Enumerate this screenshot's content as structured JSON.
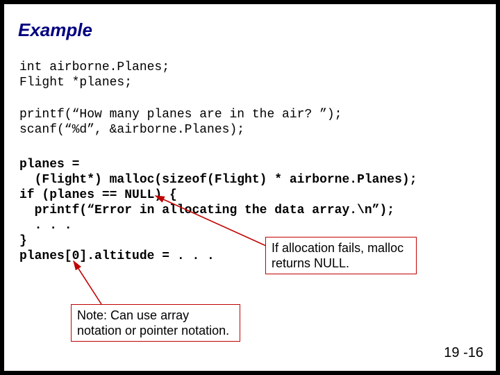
{
  "title": "Example",
  "code_block1": "int airborne.Planes;\nFlight *planes;",
  "code_block2": "printf(“How many planes are in the air? ”);\nscanf(“%d”, &airborne.Planes);",
  "code_block3": "planes =\n  (Flight*) malloc(sizeof(Flight) * airborne.Planes);\nif (planes == NULL) {\n  printf(“Error in allocating the data array.\\n”);\n  . . .\n}\nplanes[0].altitude = . . .",
  "callout1": "If allocation fails, malloc returns NULL.",
  "callout2": "Note: Can use array notation or pointer notation.",
  "page_number": "19 -16"
}
